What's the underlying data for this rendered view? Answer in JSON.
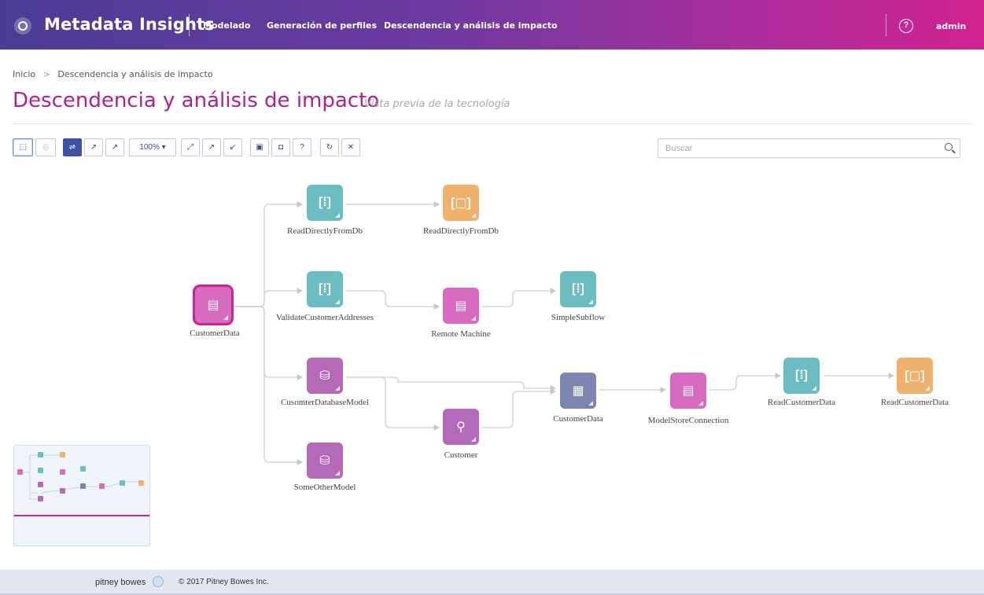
{
  "header": {
    "app_title": "Metadata Insights",
    "nav": [
      "Modelado",
      "Generación de perfiles",
      "Descendencia y análisis de impacto"
    ],
    "user": "admin",
    "gradient_start": "#4a3c96",
    "gradient_end": "#d1228f"
  },
  "breadcrumb": {
    "home": "Inicio",
    "current": "Descendencia y análisis de impacto"
  },
  "page": {
    "title": "Descendencia y análisis de impacto",
    "subtitle": "Vista previa de la tecnología"
  },
  "toolbar": {
    "zoom": "100% ▾",
    "help_label": "?",
    "buttons": [
      "select-icon",
      "radio-icon",
      "layout-icon",
      "expand-icon",
      "collapse-icon",
      "fit-icon",
      "expand-all-icon",
      "collapse-all-icon",
      "save-icon",
      "camera-icon",
      "help-icon",
      "refresh-icon",
      "close-icon"
    ]
  },
  "search": {
    "placeholder": "Buscar",
    "value": ""
  },
  "graph": {
    "nodes": [
      {
        "label": "CustomerData",
        "icon": "server-icon"
      },
      {
        "label": "ReadDirectlyFromDb",
        "icon": "dataflow-icon"
      },
      {
        "label": "ReadDirectlyFromDb",
        "icon": "subflow-icon"
      },
      {
        "label": "ValidateCustomerAddresses",
        "icon": "dataflow-icon"
      },
      {
        "label": "Remote Machine",
        "icon": "server-icon"
      },
      {
        "label": "SimpleSubflow",
        "icon": "dataflow-icon"
      },
      {
        "label": "CusomterDatabaseModel",
        "icon": "database-icon"
      },
      {
        "label": "Customer",
        "icon": "hierarchy-icon"
      },
      {
        "label": "CustomerData",
        "icon": "folder-grid-icon"
      },
      {
        "label": "ModelStoreConnection",
        "icon": "server-icon"
      },
      {
        "label": "ReadCustomerData",
        "icon": "dataflow-icon"
      },
      {
        "label": "ReadCustomerData",
        "icon": "subflow-icon"
      },
      {
        "label": "SomeOtherModel",
        "icon": "database-icon"
      }
    ],
    "colors": {
      "teal": "#6bbdc1",
      "orange": "#f0b06e",
      "pink": "#d86bbf",
      "purple": "#b46ab8",
      "slate": "#7b86b0"
    }
  },
  "footer": {
    "brand": "pitney bowes",
    "copyright": "© 2017 Pitney Bowes Inc."
  }
}
